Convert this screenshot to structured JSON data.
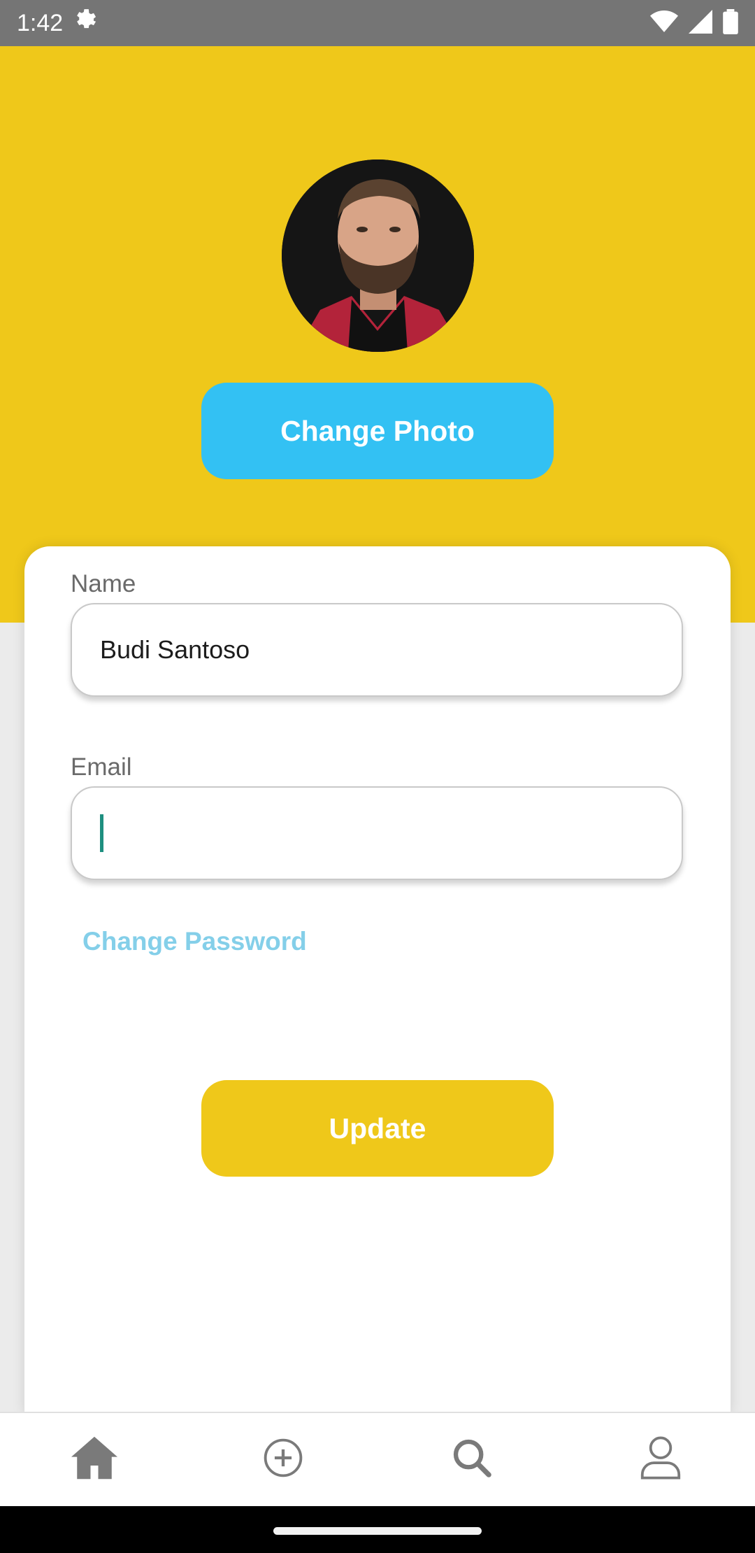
{
  "status_bar": {
    "time": "1:42",
    "icons": [
      "settings-gear-icon",
      "wifi-icon",
      "signal-icon",
      "battery-icon"
    ]
  },
  "profile": {
    "avatar_description_icon": "avatar-photo",
    "change_photo_label": "Change Photo"
  },
  "form": {
    "name_label": "Name",
    "name_value": "Budi Santoso",
    "email_label": "Email",
    "email_value": "",
    "change_password_label": "Change Password",
    "update_label": "Update"
  },
  "bottom_nav": {
    "items": [
      "home-icon",
      "add-circle-icon",
      "search-icon",
      "profile-icon"
    ]
  },
  "colors": {
    "header": "#efc81a",
    "primary_button": "#33c1f3",
    "update_button": "#efc81a",
    "link": "#84cfe9",
    "status_bar": "#757575"
  }
}
